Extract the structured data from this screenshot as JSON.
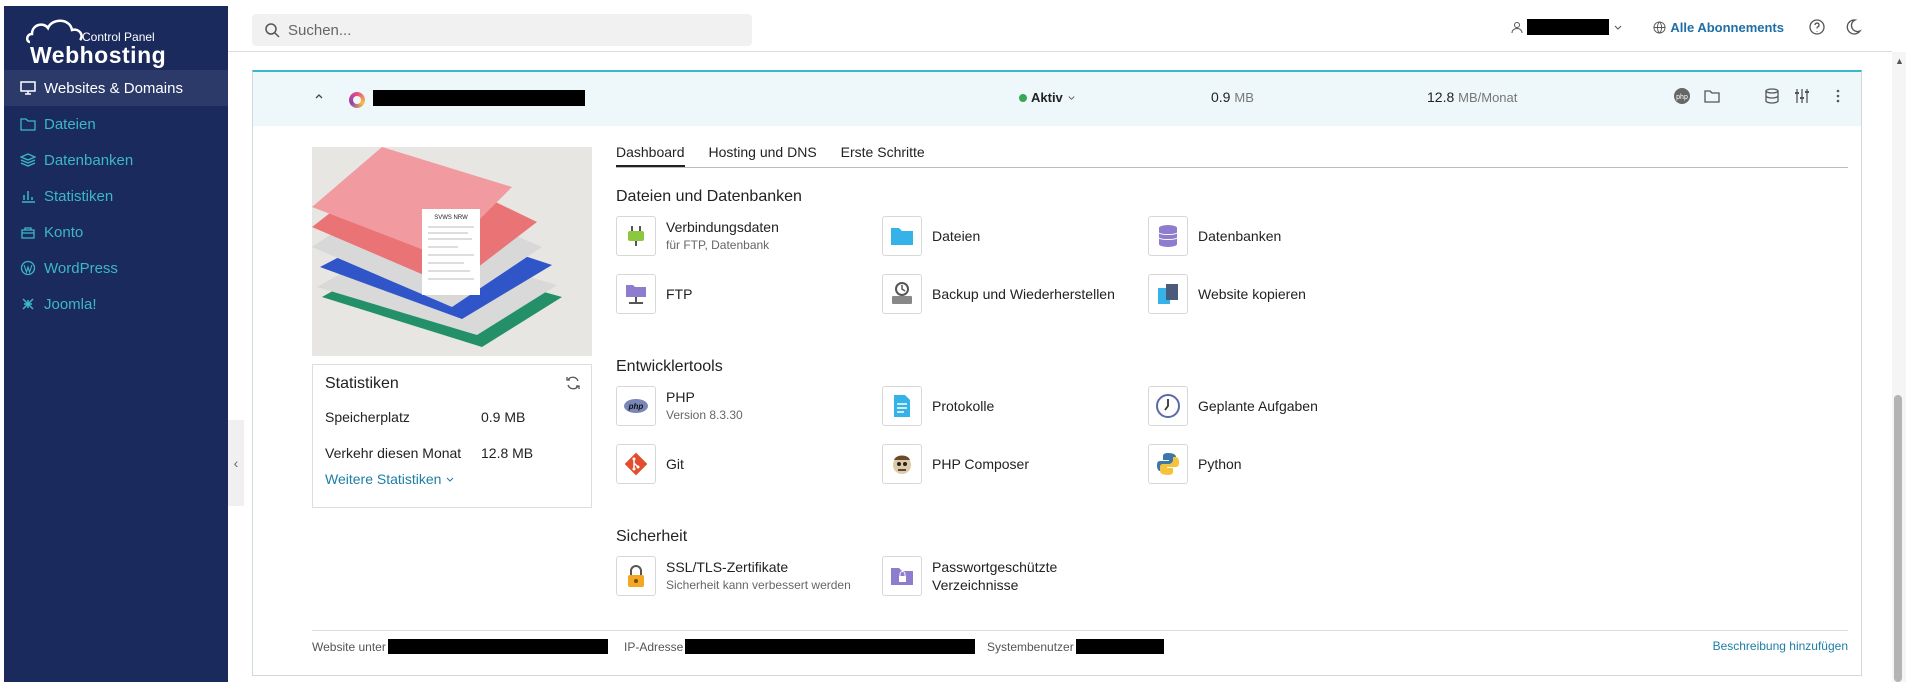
{
  "logo": {
    "line1": "Control Panel",
    "line2": "Webhosting"
  },
  "sidebar": {
    "items": [
      {
        "label": "Websites & Domains",
        "icon": "monitor-icon",
        "active": true
      },
      {
        "label": "Dateien",
        "icon": "folder-icon"
      },
      {
        "label": "Datenbanken",
        "icon": "database-icon"
      },
      {
        "label": "Statistiken",
        "icon": "bar-chart-icon"
      },
      {
        "label": "Konto",
        "icon": "briefcase-icon"
      },
      {
        "label": "WordPress",
        "icon": "wordpress-icon"
      },
      {
        "label": "Joomla!",
        "icon": "joomla-icon"
      }
    ],
    "collapse": "‹"
  },
  "header": {
    "search_placeholder": "Suchen...",
    "subscriptions": "Alle Abonnements"
  },
  "site": {
    "status": "Aktiv",
    "disk_value": "0.9",
    "disk_unit": "MB",
    "traffic_value": "12.8",
    "traffic_unit": "MB/Monat"
  },
  "tabs": [
    "Dashboard",
    "Hosting und DNS",
    "Erste Schritte"
  ],
  "stats": {
    "title": "Statistiken",
    "rows": [
      {
        "k": "Speicherplatz",
        "v": "0.9 MB"
      },
      {
        "k": "Verkehr diesen Monat",
        "v": "12.8 MB"
      }
    ],
    "more": "Weitere Statistiken"
  },
  "thumbnail": {
    "doc_title": "SVWS NRW"
  },
  "sections": {
    "files": {
      "title": "Dateien und Datenbanken",
      "tools": [
        {
          "label": "Verbindungsdaten",
          "sub": "für FTP, Datenbank",
          "icon": "plug-icon"
        },
        {
          "label": "Dateien",
          "icon": "folder-icon"
        },
        {
          "label": "Datenbanken",
          "icon": "database-icon"
        },
        {
          "label": "FTP",
          "icon": "ftp-icon"
        },
        {
          "label": "Backup und Wiederherstellen",
          "icon": "backup-icon"
        },
        {
          "label": "Website kopieren",
          "icon": "copy-icon"
        }
      ]
    },
    "dev": {
      "title": "Entwicklertools",
      "tools": [
        {
          "label": "PHP",
          "sub": "Version 8.3.30",
          "icon": "php-icon"
        },
        {
          "label": "Protokolle",
          "icon": "log-icon"
        },
        {
          "label": "Geplante Aufgaben",
          "icon": "clock-icon"
        },
        {
          "label": "Git",
          "icon": "git-icon"
        },
        {
          "label": "PHP Composer",
          "icon": "composer-icon"
        },
        {
          "label": "Python",
          "icon": "python-icon"
        }
      ]
    },
    "security": {
      "title": "Sicherheit",
      "tools": [
        {
          "label": "SSL/TLS-Zertifikate",
          "sub": "Sicherheit kann verbessert werden",
          "icon": "lock-icon"
        },
        {
          "label": "Passwortgeschützte",
          "label2": "Verzeichnisse",
          "icon": "protected-folder-icon"
        }
      ]
    }
  },
  "footer": {
    "website": "Website unter",
    "ip": "IP-Adresse",
    "sysuser": "Systembenutzer",
    "link": "Beschreibung hinzufügen"
  },
  "colors": {
    "sidebar": "#1b2a5c",
    "accent": "#3cb6c9",
    "link": "#1d7ea5",
    "active_dot": "#3aa655"
  }
}
